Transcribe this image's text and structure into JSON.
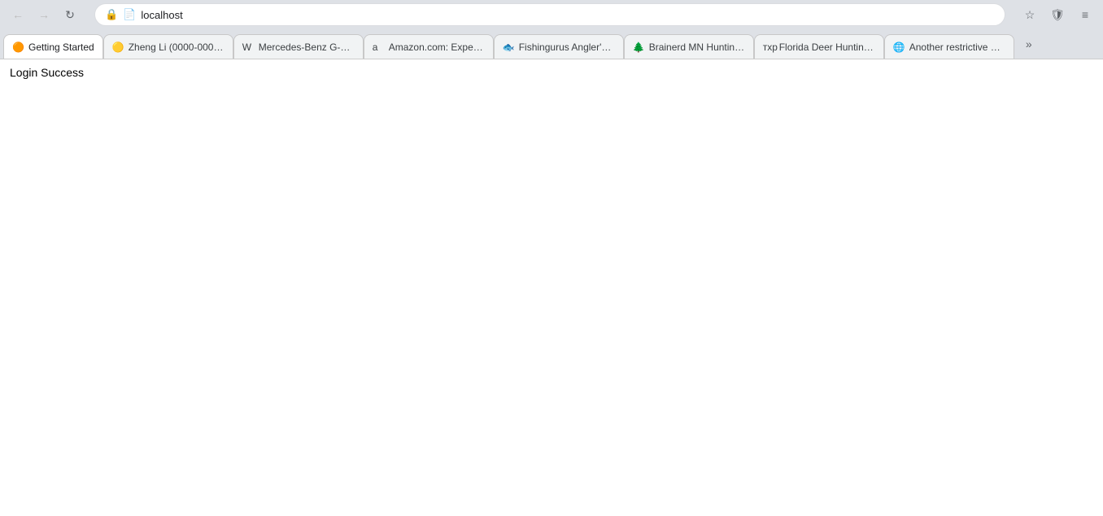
{
  "browser": {
    "url": "localhost",
    "nav": {
      "back_label": "←",
      "forward_label": "→",
      "reload_label": "↻"
    },
    "toolbar": {
      "bookmark_label": "☆",
      "shield_label": "🛡",
      "menu_label": "≡"
    }
  },
  "tabs": [
    {
      "id": "tab-getting-started",
      "label": "Getting Started",
      "favicon": "🟠",
      "active": true
    },
    {
      "id": "tab-zheng-li",
      "label": "Zheng Li (0000-0002-3...",
      "favicon": "🟡",
      "active": false
    },
    {
      "id": "tab-mercedes",
      "label": "Mercedes-Benz G-Clas...",
      "favicon": "W",
      "active": false
    },
    {
      "id": "tab-amazon",
      "label": "Amazon.com: ExpertP...",
      "favicon": "a",
      "active": false
    },
    {
      "id": "tab-fishingurus",
      "label": "Fishingurus Angler's l...",
      "favicon": "🐟",
      "active": false
    },
    {
      "id": "tab-brainerd",
      "label": "Brainerd MN Hunting ...",
      "favicon": "🌲",
      "active": false
    },
    {
      "id": "tab-florida",
      "label": "Florida Deer Hunting S...",
      "favicon": "тхр",
      "active": false
    },
    {
      "id": "tab-restrictive",
      "label": "Another restrictive dee...",
      "favicon": "🌐",
      "active": false
    }
  ],
  "tabs_overflow_label": "»",
  "page": {
    "content_text": "Login Success"
  }
}
